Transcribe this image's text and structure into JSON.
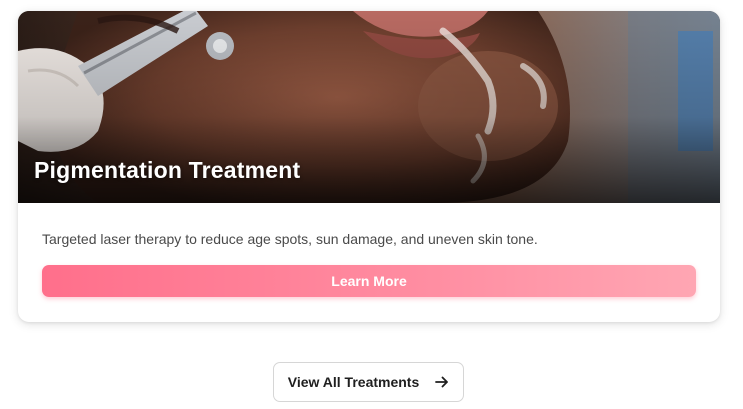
{
  "card": {
    "title": "Pigmentation Treatment",
    "description": "Targeted laser therapy to reduce age spots, sun damage, and uneven skin tone.",
    "cta_label": "Learn More",
    "image_icon": "laser-treatment-photo"
  },
  "footer": {
    "view_all_label": "View All Treatments",
    "arrow_icon": "arrow-right-icon"
  },
  "colors": {
    "accent_start": "#ff6f8b",
    "accent_end": "#ffa6b3",
    "title_text": "#ffffff",
    "body_text": "#4a4a4a"
  }
}
